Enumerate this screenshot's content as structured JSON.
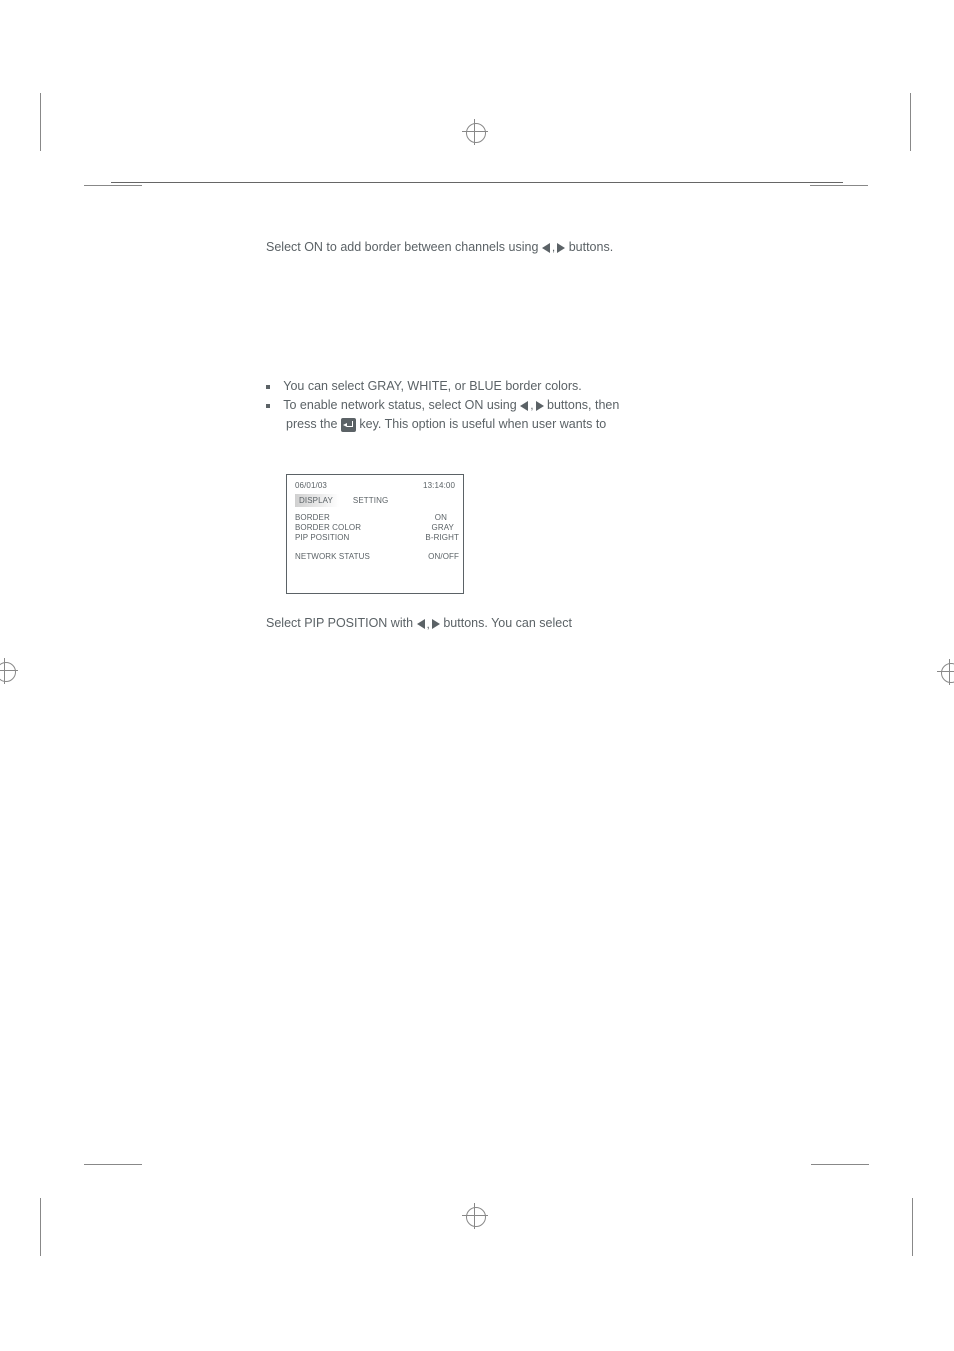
{
  "p1": {
    "a": "Select ON to add border between channels using ",
    "b": "buttons."
  },
  "notes": {
    "a": "You can select GRAY, WHITE, or BLUE border colors.",
    "b_a": "To enable network status, select ON using ",
    "b_b": "buttons, then",
    "b2_a": "press the ",
    "b2_b": "key. This option is useful when user wants to"
  },
  "osd": {
    "date": "06/01/03",
    "time": "13:14:00",
    "tab1": "DISPLAY",
    "tab2": "SETTING",
    "r1a": "BORDER",
    "r1b": "ON",
    "r2a": "BORDER COLOR",
    "r2b": "GRAY",
    "r3a": "PIP POSITION",
    "r3b": "B-RIGHT",
    "r4a": "NETWORK STATUS",
    "r4b": "ON/OFF"
  },
  "p2": {
    "a": "Select PIP POSITION with ",
    "b": "buttons. You can select"
  }
}
